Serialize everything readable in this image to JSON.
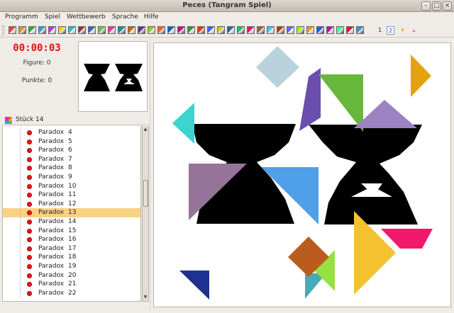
{
  "window": {
    "title": "Peces (Tangram Spiel)"
  },
  "menu": [
    "Programm",
    "Spiel",
    "Wettbewerb",
    "Sprache",
    "Hilfe"
  ],
  "toolbar": {
    "label_1": "1",
    "label_2": "2"
  },
  "status": {
    "timer": "00:00:03",
    "figure": "Figure: 0",
    "points": "Punkte: 0"
  },
  "tree": {
    "header": "Stück 14",
    "items": [
      {
        "name": "Paradox",
        "num": "4"
      },
      {
        "name": "Paradox",
        "num": "5"
      },
      {
        "name": "Paradox",
        "num": "6"
      },
      {
        "name": "Paradox",
        "num": "7"
      },
      {
        "name": "Paradox",
        "num": "8"
      },
      {
        "name": "Paradox",
        "num": "9"
      },
      {
        "name": "Paradox",
        "num": "10"
      },
      {
        "name": "Paradox",
        "num": "11"
      },
      {
        "name": "Paradox",
        "num": "12"
      },
      {
        "name": "Paradox",
        "num": "13"
      },
      {
        "name": "Paradox",
        "num": "14"
      },
      {
        "name": "Paradox",
        "num": "15"
      },
      {
        "name": "Paradox",
        "num": "16"
      },
      {
        "name": "Paradox",
        "num": "17"
      },
      {
        "name": "Paradox",
        "num": "18"
      },
      {
        "name": "Paradox",
        "num": "19"
      },
      {
        "name": "Paradox",
        "num": "20"
      },
      {
        "name": "Paradox",
        "num": "21"
      },
      {
        "name": "Paradox",
        "num": "22"
      }
    ],
    "selected_index": 9
  },
  "colors": {
    "timer": "#e01010",
    "selection": "#f9d184",
    "piece_light_blue": "#b9d2dd",
    "piece_orange": "#e4a30c",
    "piece_purple": "#6a4fae",
    "piece_green": "#68b73d",
    "piece_lavender": "#9b83c3",
    "piece_cyan": "#3bd4cf",
    "piece_mauve": "#967499",
    "piece_blue": "#4fa0e8",
    "piece_yellow": "#f4c230",
    "piece_pink": "#f2186b",
    "piece_brown": "#bb5c1f",
    "piece_lime": "#95e042",
    "piece_teal": "#4aa9b7",
    "piece_navy": "#1e3190"
  }
}
